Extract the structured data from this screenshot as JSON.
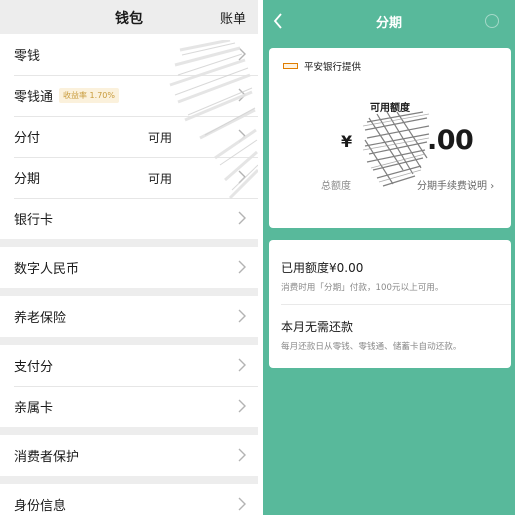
{
  "wallet": {
    "title": "钱包",
    "bill_label": "账单",
    "rows": [
      {
        "label": "零钱"
      },
      {
        "label": "零钱通",
        "rate_badge": "收益率 1.70%"
      },
      {
        "label": "分付",
        "availability": "可用"
      },
      {
        "label": "分期",
        "availability": "可用"
      },
      {
        "label": "银行卡"
      },
      {
        "label": "数字人民币"
      },
      {
        "label": "养老保险"
      },
      {
        "label": "支付分"
      },
      {
        "label": "亲属卡"
      },
      {
        "label": "消费者保护"
      },
      {
        "label": "身份信息"
      }
    ]
  },
  "installment": {
    "title": "分期",
    "provider": "平安银行提供",
    "available_label": "可用额度",
    "currency": "¥",
    "amount_visible": ".00",
    "total_label": "总额度",
    "fee_link": "分期手续费说明",
    "used_title": "已用额度¥0.00",
    "used_desc": "消费时用「分期」付款，100元以上可用。",
    "repay_title": "本月无需还款",
    "repay_desc": "每月还款日从零钱、零钱通、储蓄卡自动还款。"
  },
  "colors": {
    "accent_green": "#58b99b",
    "badge_text": "#c89b3c",
    "badge_bg": "#fbf1dc",
    "page_bg": "#ededed"
  },
  "icons": [
    "chevron-right-icon",
    "back-arrow-icon",
    "more-icon",
    "bank-logo-icon"
  ]
}
